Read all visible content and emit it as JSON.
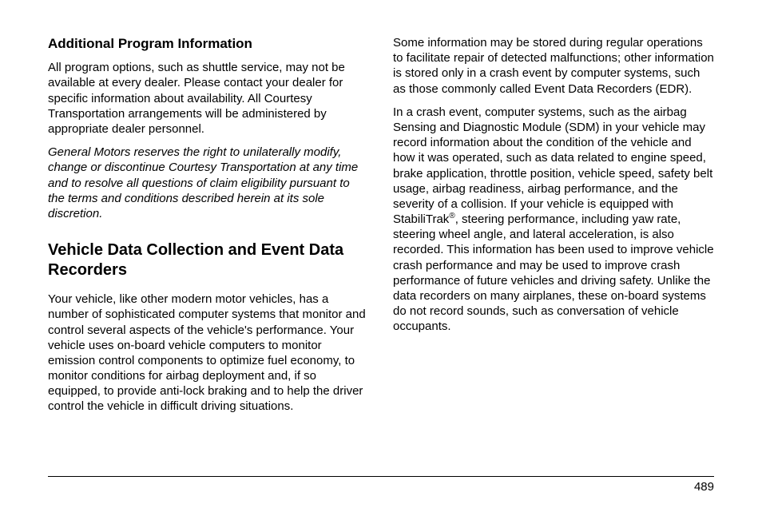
{
  "left": {
    "h1": "Additional Program Information",
    "p1": "All program options, such as shuttle service, may not be available at every dealer. Please contact your dealer for specific information about availability. All Courtesy Transportation arrangements will be administered by appropriate dealer personnel.",
    "p2": "General Motors reserves the right to unilaterally modify, change or discontinue Courtesy Transportation at any time and to resolve all questions of claim eligibility pursuant to the terms and conditions described herein at its sole discretion.",
    "h2": "Vehicle Data Collection and Event Data Recorders",
    "p3": "Your vehicle, like other modern motor vehicles, has a number of sophisticated computer systems that monitor and control several aspects of the vehicle's performance. Your vehicle uses on-board vehicle computers to monitor emission control components to optimize fuel economy, to monitor conditions for airbag deployment and, if so equipped, to provide anti-lock braking and to help the driver control the vehicle in difficult driving situations."
  },
  "right": {
    "p1": "Some information may be stored during regular operations to facilitate repair of detected malfunctions; other information is stored only in a crash event by computer systems, such as those commonly called Event Data Recorders (EDR).",
    "p2a": "In a crash event, computer systems, such as the airbag Sensing and Diagnostic Module (SDM) in your vehicle may record information about the condition of the vehicle and how it was operated, such as data related to engine speed, brake application, throttle position, vehicle speed, safety belt usage, airbag readiness, airbag performance, and the severity of a collision. If your vehicle is equipped with StabiliTrak",
    "p2sup": "®",
    "p2b": ", steering performance, including yaw rate, steering wheel angle, and lateral acceleration, is also recorded. This information has been used to improve vehicle crash performance and may be used to improve crash performance of future vehicles and driving safety. Unlike the data recorders on many airplanes, these on-board systems do not record sounds, such as conversation of vehicle occupants."
  },
  "pagenum": "489"
}
